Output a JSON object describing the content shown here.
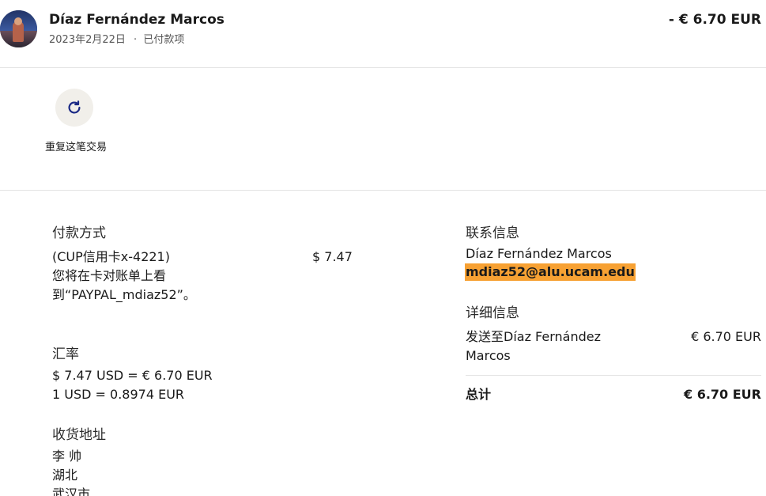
{
  "header": {
    "name": "Díaz Fernández Marcos",
    "date": "2023年2月22日",
    "separator": "·",
    "status": "已付款项",
    "amount": "- € 6.70 EUR"
  },
  "repeat": {
    "icon": "refresh-icon",
    "label": "重复这笔交易"
  },
  "payment": {
    "title": "付款方式",
    "card": "(CUP信用卡x-4221)",
    "note": "您将在卡对账单上看到“PAYPAL_mdiaz52”。",
    "amount": "$ 7.47"
  },
  "exchange": {
    "title": "汇率",
    "line1": "$ 7.47 USD = € 6.70 EUR",
    "line2": "1 USD = 0.8974 EUR"
  },
  "shipping": {
    "title": "收货地址",
    "line1": "李 帅",
    "line2": "湖北",
    "line3": "武汉市"
  },
  "contact": {
    "title": "联系信息",
    "name": "Díaz Fernández Marcos",
    "email": "mdiaz52@alu.ucam.edu"
  },
  "details": {
    "title": "详细信息",
    "sent_to": "发送至Díaz Fernández Marcos",
    "amount": "€ 6.70 EUR",
    "total_label": "总计",
    "total_amount": "€ 6.70 EUR"
  },
  "colors": {
    "highlight": "#f7a133",
    "icon": "#1b2a86",
    "divider": "#e4e4e4"
  }
}
